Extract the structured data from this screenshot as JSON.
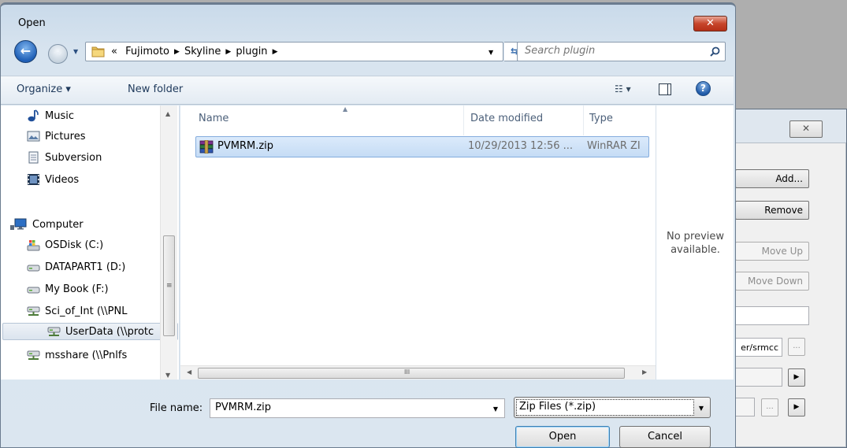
{
  "background_dialog": {
    "buttons": [
      "Add...",
      "Remove",
      "Move Up",
      "Move Down"
    ],
    "path_value": "er/srmcc",
    "small_button": "..."
  },
  "dialog": {
    "title": "Open",
    "close_label": "✕"
  },
  "address": {
    "prefix": "«",
    "crumbs": [
      "Fujimoto",
      "Skyline",
      "plugin"
    ],
    "search_placeholder": "Search plugin"
  },
  "toolbar": {
    "organize": "Organize ▾",
    "new_folder": "New folder",
    "views": "☷ ▾",
    "help": "?"
  },
  "nav": {
    "items": [
      {
        "label": "Music",
        "icon": "music-icon"
      },
      {
        "label": "Pictures",
        "icon": "pictures-icon"
      },
      {
        "label": "Subversion",
        "icon": "subversion-icon"
      },
      {
        "label": "Videos",
        "icon": "videos-icon"
      },
      {
        "label": "Computer",
        "icon": "computer-icon"
      },
      {
        "label": "OSDisk (C:)",
        "icon": "system-drive-icon"
      },
      {
        "label": "DATAPART1 (D:)",
        "icon": "drive-icon"
      },
      {
        "label": "My Book (F:)",
        "icon": "drive-icon"
      },
      {
        "label": "Sci_of_Int (\\\\PNL",
        "icon": "network-drive-icon"
      },
      {
        "label": "UserData (\\\\protc",
        "icon": "network-drive-icon"
      },
      {
        "label": "msshare (\\\\Pnlfs",
        "icon": "network-drive-icon"
      }
    ],
    "selected_index": 9
  },
  "columns": {
    "name": "Name",
    "date_modified": "Date modified",
    "type": "Type"
  },
  "files": [
    {
      "name": "PVMRM.zip",
      "date_modified": "10/29/2013 12:56 ...",
      "type": "WinRAR ZI",
      "icon": "winrar-archive-icon"
    }
  ],
  "preview": {
    "line1": "No preview",
    "line2": "available."
  },
  "footer": {
    "file_name_label": "File name:",
    "file_name_value": "PVMRM.zip",
    "file_type": "Zip Files (*.zip)",
    "open": "Open",
    "cancel": "Cancel"
  }
}
